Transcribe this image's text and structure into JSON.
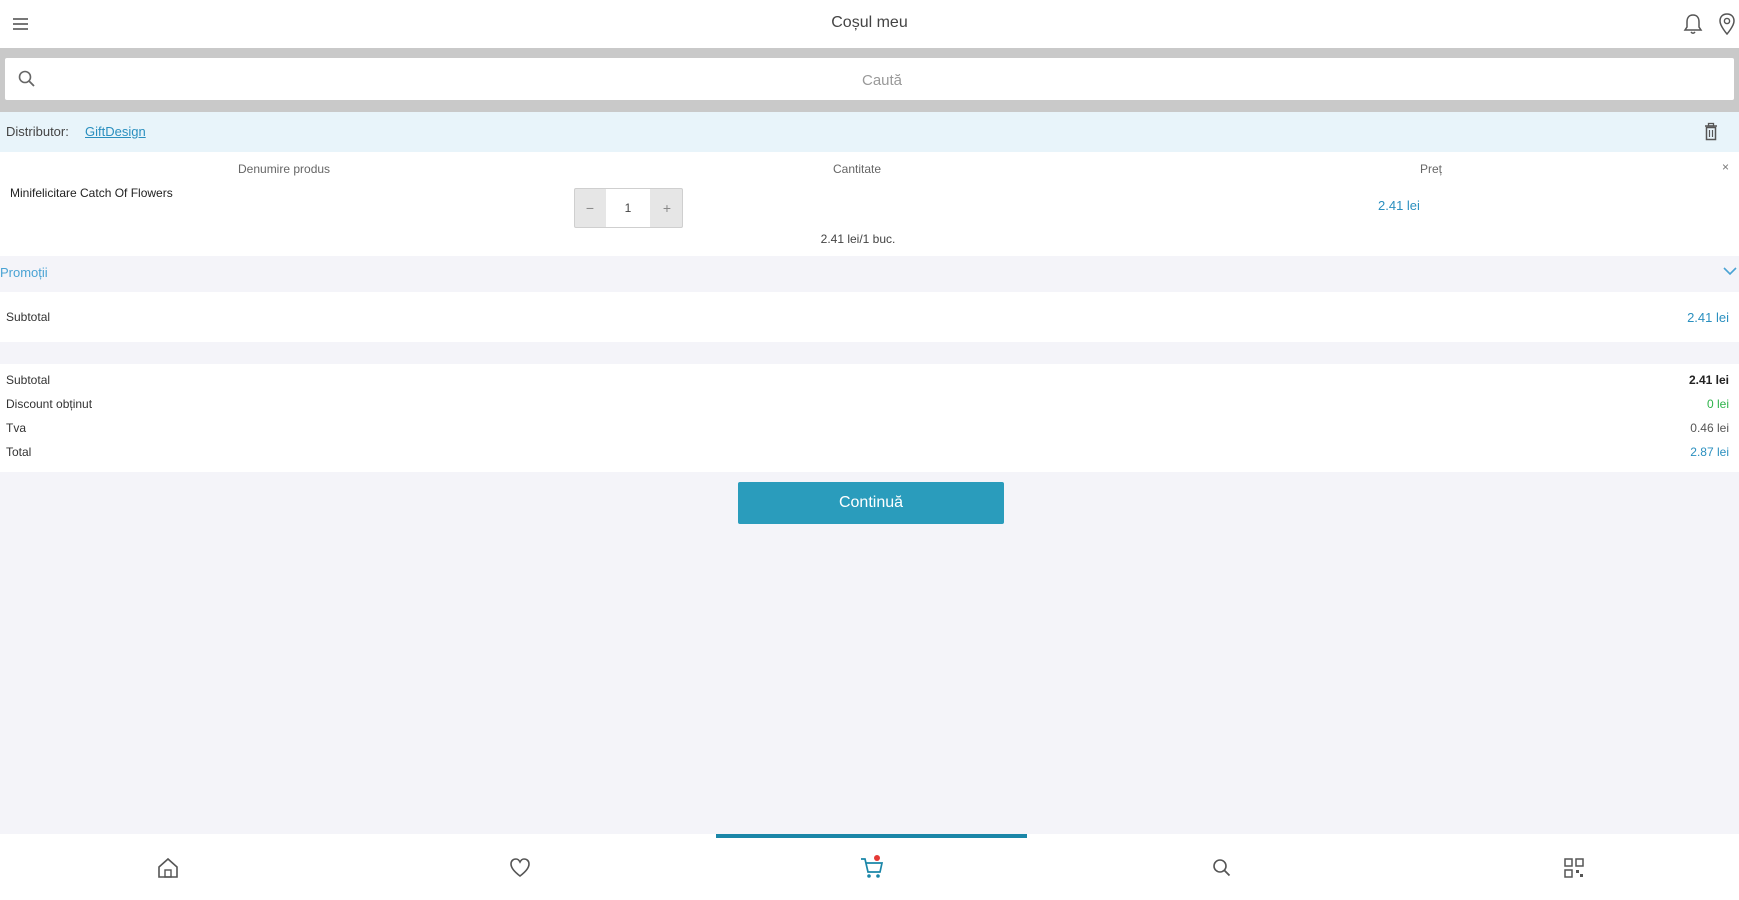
{
  "header": {
    "title": "Coșul meu",
    "menu_icon": "hamburger-menu-icon",
    "bell_icon": "bell-icon",
    "location_icon": "location-pin-icon"
  },
  "search": {
    "placeholder": "Caută",
    "value": ""
  },
  "distributor": {
    "label": "Distributor:",
    "name": "GiftDesign"
  },
  "cart_table": {
    "headers": {
      "product": "Denumire produs",
      "quantity": "Cantitate",
      "price": "Preț"
    },
    "remove_symbol": "×",
    "items": [
      {
        "name": "Minifelicitare Catch Of Flowers",
        "quantity": "1",
        "minus": "−",
        "plus": "+",
        "unit_price": "2.41 lei/1 buc.",
        "line_price": "2.41 lei"
      }
    ]
  },
  "promotions": {
    "label": "Promoții"
  },
  "group_subtotal": {
    "label": "Subtotal",
    "value": "2.41 lei"
  },
  "totals": [
    {
      "label": "Subtotal",
      "value": "2.41 lei",
      "color": "#222222"
    },
    {
      "label": "Discount obținut",
      "value": "0 lei",
      "color": "#2db34a"
    },
    {
      "label": "Tva",
      "value": "0.46 lei",
      "color": "#555555"
    },
    {
      "label": "Total",
      "value": "2.87 lei",
      "color": "#2a8fbf"
    }
  ],
  "continue_button": {
    "label": "Continuă"
  },
  "bottom_nav": {
    "items": [
      "home-icon",
      "heart-icon",
      "cart-icon",
      "search-icon",
      "qr-code-icon"
    ],
    "active": "cart-icon"
  },
  "colors": {
    "accent": "#2a9cbc",
    "link": "#2a8fbf",
    "nav_indicator": "#1a86a8",
    "distributor_bg": "#e8f4fa"
  }
}
